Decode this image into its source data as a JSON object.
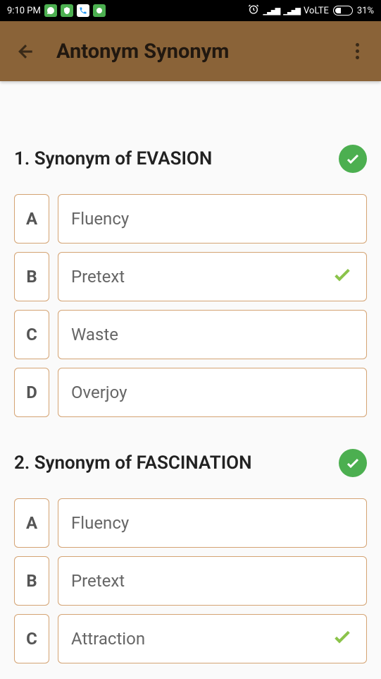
{
  "status": {
    "time": "9:10 PM",
    "volte": "VoLTE",
    "battery": "31%"
  },
  "header": {
    "title": "Antonym Synonym"
  },
  "questions": [
    {
      "number": "1",
      "text": "1. Synonym of EVASION",
      "options": [
        {
          "letter": "A",
          "text": "Fluency",
          "correct": false
        },
        {
          "letter": "B",
          "text": "Pretext",
          "correct": true
        },
        {
          "letter": "C",
          "text": "Waste",
          "correct": false
        },
        {
          "letter": "D",
          "text": "Overjoy",
          "correct": false
        }
      ]
    },
    {
      "number": "2",
      "text": "2. Synonym of FASCINATION",
      "options": [
        {
          "letter": "A",
          "text": "Fluency",
          "correct": false
        },
        {
          "letter": "B",
          "text": "Pretext",
          "correct": false
        },
        {
          "letter": "C",
          "text": "Attraction",
          "correct": true
        }
      ]
    }
  ]
}
